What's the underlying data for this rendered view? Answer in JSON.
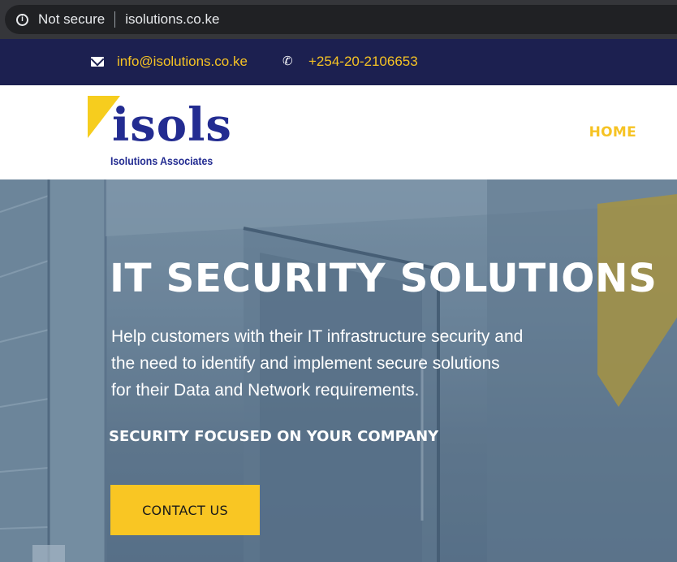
{
  "browser": {
    "security_label": "Not secure",
    "url": "isolutions.co.ke"
  },
  "topbar": {
    "email": "info@isolutions.co.ke",
    "phone": "+254-20-2106653"
  },
  "header": {
    "logo_word": "isols",
    "logo_subtitle": "Isolutions Associates",
    "nav_home": "HOME"
  },
  "hero": {
    "title": "IT SECURITY SOLUTIONS",
    "description_lines": [
      "Help customers with their IT infrastructure security and",
      "the need to identify and implement secure solutions",
      "for their Data and Network requirements."
    ],
    "tagline": "SECURITY FOCUSED ON YOUR COMPANY",
    "button_label": "CONTACT US"
  },
  "colors": {
    "topbar_bg": "#1c2050",
    "accent_yellow": "#f6c324",
    "logo_blue": "#232c91"
  },
  "icons": {
    "browser_info": "info-icon",
    "email": "envelope-icon",
    "phone": "phone-icon"
  }
}
